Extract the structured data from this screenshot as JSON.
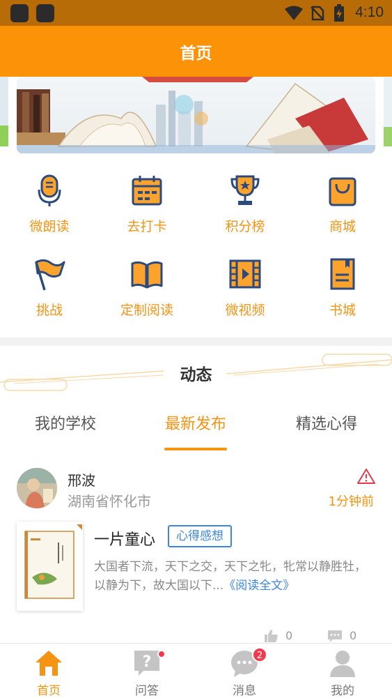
{
  "status_bar": {
    "time": "4:10"
  },
  "header": {
    "title": "首页"
  },
  "colors": {
    "brand": "#fb9208",
    "accent": "#f59312",
    "link": "#3d86e0",
    "badge": "#f23a4e"
  },
  "menu": [
    {
      "label": "微朗读",
      "icon": "microphone-icon"
    },
    {
      "label": "去打卡",
      "icon": "calendar-icon"
    },
    {
      "label": "积分榜",
      "icon": "trophy-icon"
    },
    {
      "label": "商城",
      "icon": "shopping-bag-icon"
    },
    {
      "label": "挑战",
      "icon": "flag-icon"
    },
    {
      "label": "定制阅读",
      "icon": "open-book-icon"
    },
    {
      "label": "微视频",
      "icon": "video-icon"
    },
    {
      "label": "书城",
      "icon": "book-icon"
    }
  ],
  "section": {
    "title": "动态"
  },
  "tabs": [
    {
      "label": "我的学校",
      "active": false
    },
    {
      "label": "最新发布",
      "active": true
    },
    {
      "label": "精选心得",
      "active": false
    }
  ],
  "post": {
    "author": "邢波",
    "location": "湖南省怀化市",
    "time_ago": "1分钟前",
    "title": "一片童心",
    "tag": "心得感想",
    "excerpt": "大国者下流，天下之交，天下之牝，牝常以静胜牡，以静为下，故大国以下...",
    "read_more": "《阅读全文》",
    "likes": "0",
    "comments": "0"
  },
  "tabbar": [
    {
      "label": "首页",
      "icon": "home-icon",
      "active": true
    },
    {
      "label": "问答",
      "icon": "question-icon",
      "active": false
    },
    {
      "label": "消息",
      "icon": "message-icon",
      "active": false,
      "badge": "2"
    },
    {
      "label": "我的",
      "icon": "user-icon",
      "active": false
    }
  ]
}
